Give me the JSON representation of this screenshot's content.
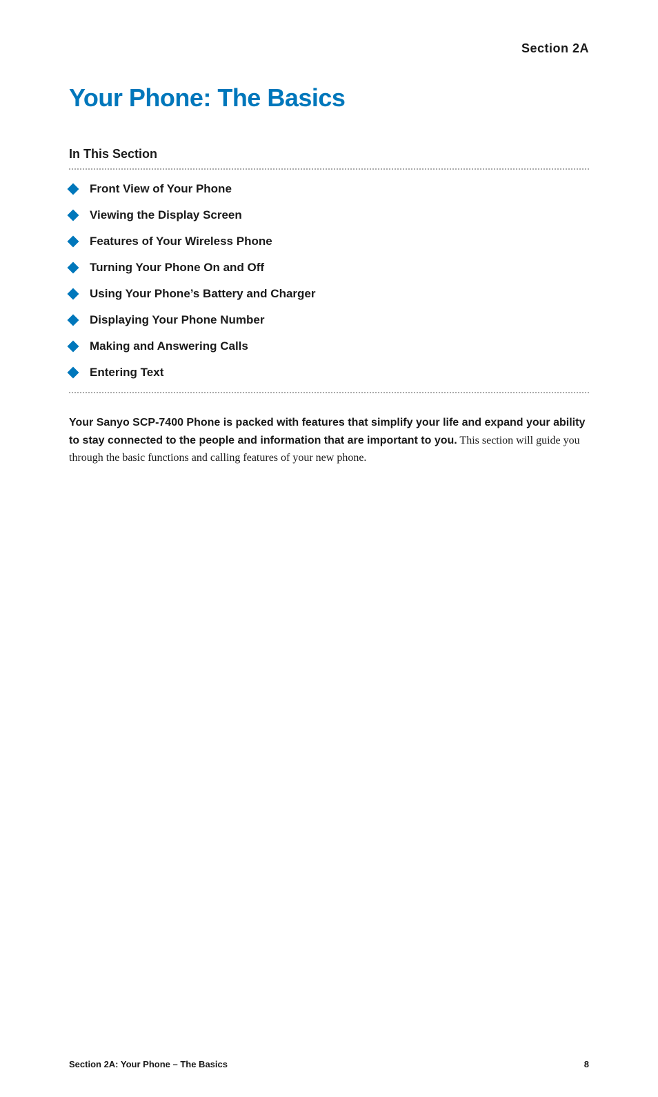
{
  "header": {
    "section_label": "Section 2A"
  },
  "page_title": "Your Phone: The Basics",
  "in_this_section": {
    "heading": "In This Section",
    "items": [
      {
        "label": "Front View of Your Phone"
      },
      {
        "label": "Viewing the Display Screen"
      },
      {
        "label": "Features of Your Wireless Phone"
      },
      {
        "label": "Turning Your Phone On and Off"
      },
      {
        "label": "Using Your Phone’s Battery and Charger"
      },
      {
        "label": "Displaying Your Phone Number"
      },
      {
        "label": "Making and Answering Calls"
      },
      {
        "label": "Entering Text"
      }
    ]
  },
  "intro": {
    "bold_text": "Your Sanyo SCP-7400 Phone is packed with features that simplify your life and expand your ability to stay connected to the people and information that are important to you.",
    "normal_text": " This section will guide you through the basic functions and calling features of your new phone."
  },
  "footer": {
    "left_text": "Section 2A: Your Phone – The Basics",
    "right_text": "8"
  }
}
